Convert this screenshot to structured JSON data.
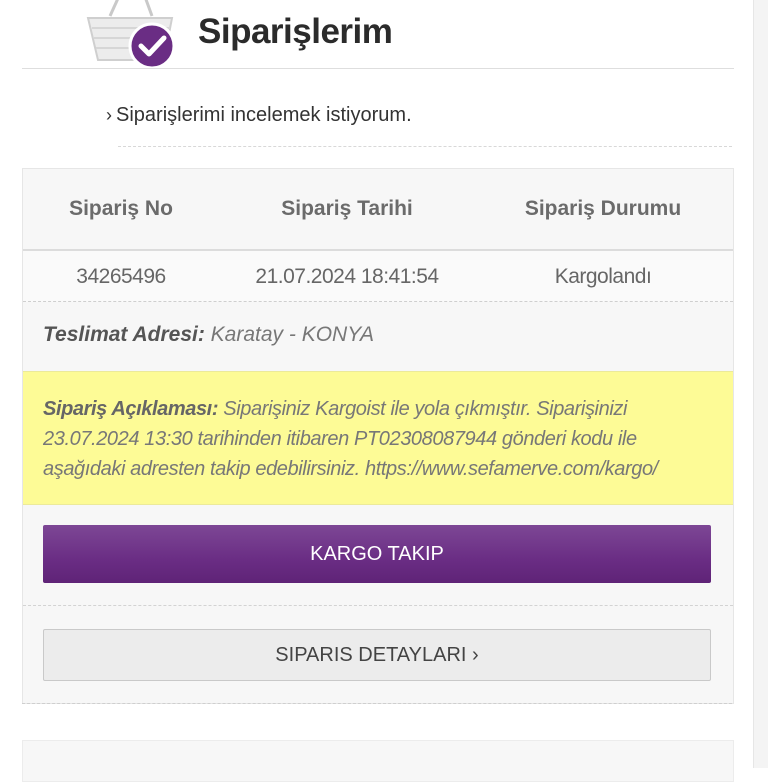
{
  "header": {
    "title": "Siparişlerim",
    "icon": "shopping-basket-check-icon"
  },
  "intro": {
    "arrow": "›",
    "text": "Siparişlerimi incelemek istiyorum."
  },
  "order_table": {
    "columns": [
      "Sipariş No",
      "Sipariş Tarihi",
      "Sipariş Durumu"
    ],
    "row": {
      "order_no": "34265496",
      "order_date": "21.07.2024 18:41:54",
      "status": "Kargolandı"
    }
  },
  "address": {
    "label": "Teslimat Adresi:",
    "value": "Karatay - KONYA"
  },
  "note": {
    "label": "Sipariş Açıklaması:",
    "text": "Siparişiniz Kargoist ile yola çıkmıştır. Siparişinizi 23.07.2024 13:30 tarihinden itibaren PT02308087944 gönderi kodu ile aşağıdaki adresten takip edebilirsiniz. https://www.sefamerve.com/kargo/"
  },
  "buttons": {
    "track": "KARGO TAKIP",
    "details": "SIPARIS DETAYLARI ›"
  },
  "colors": {
    "accent_purple": "#6a2d84",
    "note_yellow": "#fdfb96"
  }
}
